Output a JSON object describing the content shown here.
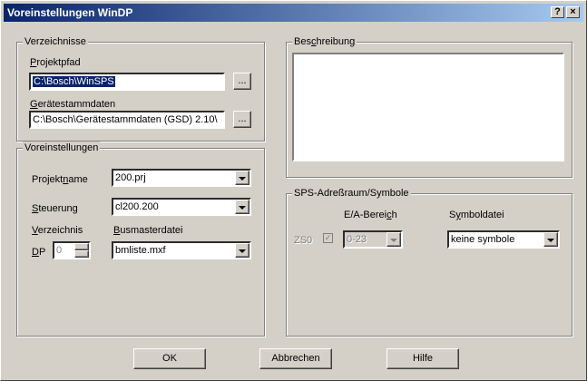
{
  "window": {
    "title": "Voreinstellungen WinDP",
    "help_glyph": "?",
    "close_glyph": "×"
  },
  "verzeichnisse": {
    "legend": "Verzeichnisse",
    "projektpfad_label": "Projektpfad",
    "projektpfad_value": "C:\\Bosch\\WinSPS",
    "geraetestamm_label": "Gerätestammdaten",
    "geraetestamm_value": "C:\\Bosch\\Gerätestammdaten (GSD) 2.10\\",
    "browse_label": "..."
  },
  "voreinstellungen": {
    "legend": "Voreinstellungen",
    "projektname_label": "Projektname",
    "projektname_value": "200.prj",
    "steuerung_label": "Steuerung",
    "steuerung_value": "cl200.200",
    "verzeichnis_label": "Verzeichnis",
    "busmaster_label": "Busmasterdatei",
    "dp_label": "DP",
    "dp_value": "0",
    "busmaster_value": "bmliste.mxf"
  },
  "beschreibung": {
    "legend": "Beschreibung",
    "text": ""
  },
  "sps": {
    "legend": "SPS-Adreßraum/Symbole",
    "ea_bereich_header": "E/A-Bereich",
    "symboldatei_header": "Symboldatei",
    "zs0_label": "ZS0",
    "ea_value": "0-23",
    "symbol_value": "keine symbole"
  },
  "buttons": {
    "ok": "OK",
    "abbrechen": "Abbrechen",
    "hilfe": "Hilfe"
  }
}
